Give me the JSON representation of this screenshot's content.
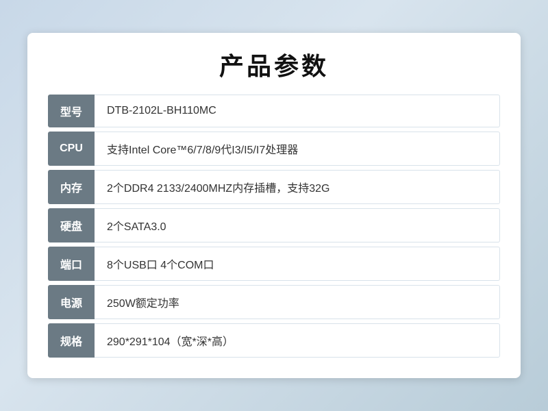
{
  "title": "产品参数",
  "rows": [
    {
      "label": "型号",
      "value": "DTB-2102L-BH110MC"
    },
    {
      "label": "CPU",
      "value": "支持Intel Core™6/7/8/9代I3/I5/I7处理器"
    },
    {
      "label": "内存",
      "value": "2个DDR4 2133/2400MHZ内存插槽，支持32G"
    },
    {
      "label": "硬盘",
      "value": "2个SATA3.0"
    },
    {
      "label": "端口",
      "value": "8个USB口 4个COM口"
    },
    {
      "label": "电源",
      "value": "250W额定功率"
    },
    {
      "label": "规格",
      "value": "290*291*104（宽*深*高）"
    }
  ]
}
